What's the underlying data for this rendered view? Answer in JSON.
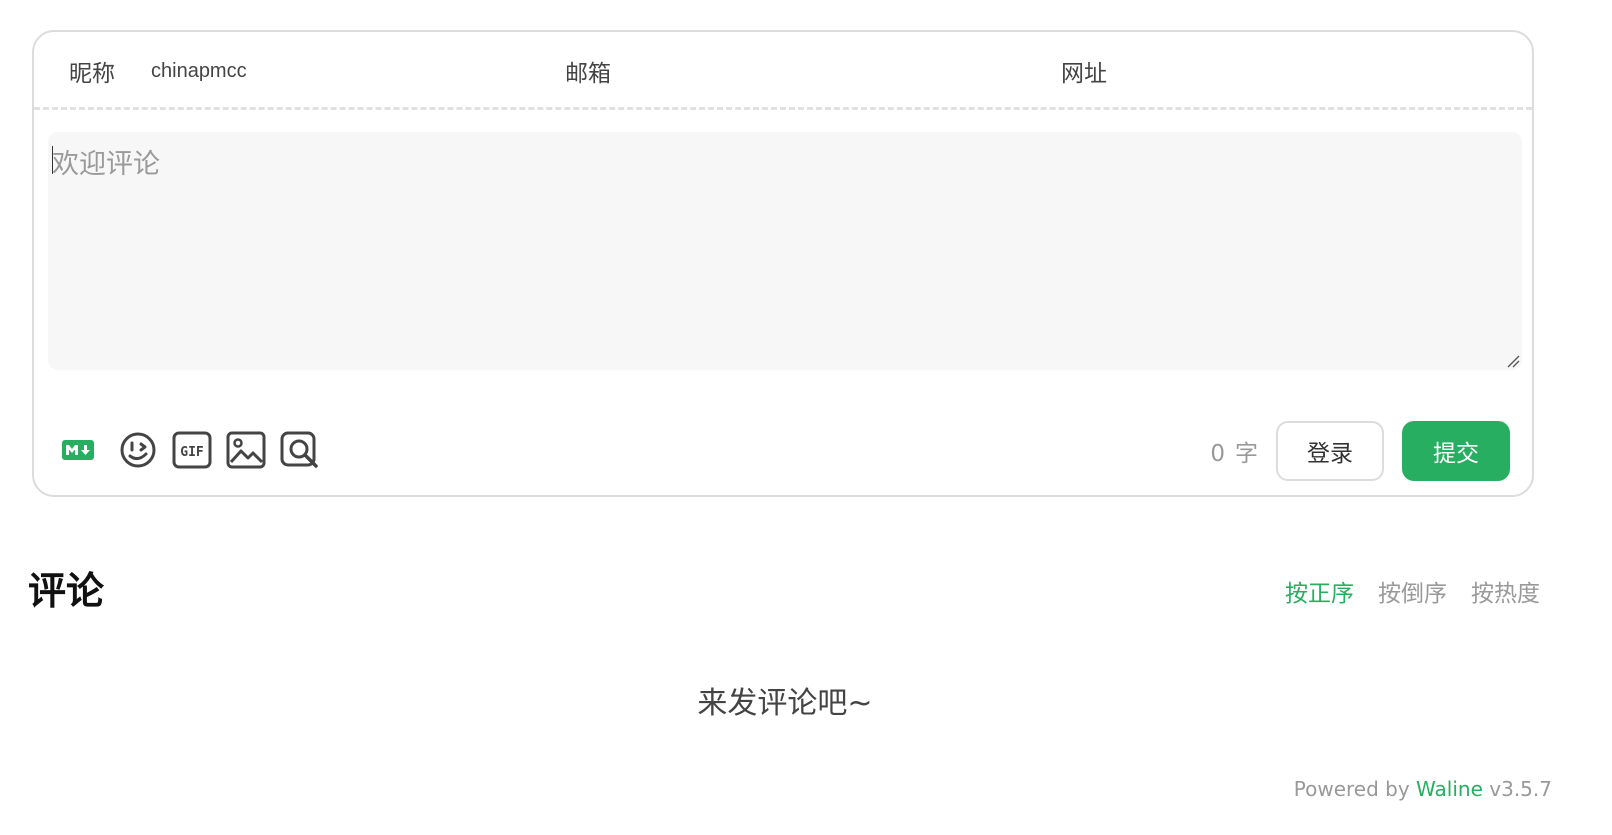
{
  "form": {
    "nick_label": "昵称",
    "nick_value": "chinapmcc",
    "mail_label": "邮箱",
    "mail_value": "",
    "link_label": "网址",
    "link_value": "",
    "editor_placeholder": "欢迎评论"
  },
  "toolbar": {
    "icons": [
      "markdown-icon",
      "emoji-icon",
      "gif-icon",
      "image-icon",
      "preview-icon"
    ],
    "word_count": "0",
    "word_unit": "字",
    "login_label": "登录",
    "submit_label": "提交"
  },
  "comments": {
    "title": "评论",
    "sort_tabs": [
      {
        "label": "按正序",
        "active": true
      },
      {
        "label": "按倒序",
        "active": false
      },
      {
        "label": "按热度",
        "active": false
      }
    ],
    "empty_message": "来发评论吧~"
  },
  "footer": {
    "powered_prefix": "Powered by",
    "brand": "Waline",
    "version": "v3.5.7"
  },
  "colors": {
    "accent": "#27ae60",
    "border": "#dcdcdc",
    "editor_bg": "#f7f7f7"
  }
}
